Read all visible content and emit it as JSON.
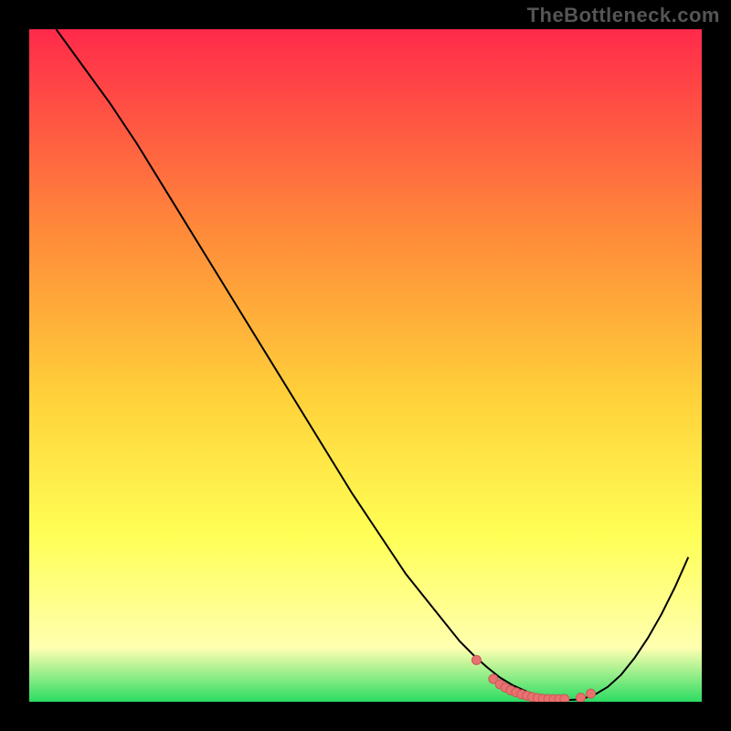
{
  "watermark": "TheBottleneck.com",
  "colors": {
    "page_bg": "#000000",
    "text": "#555555",
    "curve": "#000000",
    "marker_fill": "#e9716f",
    "marker_stroke": "#c95a58",
    "gradient_top": "#ff2a4a",
    "gradient_mid1": "#ff8a3a",
    "gradient_mid2": "#ffd23a",
    "gradient_mid3": "#ffff55",
    "gradient_mid4": "#ffffb0",
    "gradient_bottom": "#2bdc62"
  },
  "chart_data": {
    "type": "line",
    "title": "",
    "xlabel": "",
    "ylabel": "",
    "xlim": [
      0,
      100
    ],
    "ylim": [
      0,
      100
    ],
    "grid": false,
    "legend": false,
    "series": [
      {
        "name": "bottleneck-curve",
        "x": [
          4,
          8,
          12,
          16,
          20,
          24,
          28,
          32,
          36,
          40,
          44,
          48,
          52,
          56,
          60,
          64,
          66,
          68,
          70,
          72,
          74,
          76,
          78,
          80,
          82,
          84,
          86,
          88,
          90,
          92,
          94,
          96,
          98
        ],
        "y": [
          100,
          94.5,
          89,
          83,
          76.5,
          70,
          63.5,
          57,
          50.5,
          44,
          37.5,
          31,
          25,
          19,
          14,
          9,
          7,
          5.2,
          3.6,
          2.4,
          1.5,
          0.8,
          0.4,
          0.25,
          0.35,
          1.0,
          2.2,
          4.0,
          6.5,
          9.5,
          13.0,
          17.0,
          21.5
        ]
      }
    ],
    "markers": {
      "name": "basin-dots",
      "x": [
        66.5,
        69.0,
        70.0,
        70.8,
        71.6,
        72.4,
        73.2,
        74.0,
        74.8,
        75.6,
        76.4,
        77.2,
        78.0,
        78.8,
        79.6,
        82.0,
        83.5
      ],
      "y": [
        6.2,
        3.4,
        2.6,
        2.1,
        1.7,
        1.4,
        1.1,
        0.9,
        0.7,
        0.55,
        0.45,
        0.4,
        0.38,
        0.38,
        0.4,
        0.6,
        1.2
      ]
    }
  }
}
